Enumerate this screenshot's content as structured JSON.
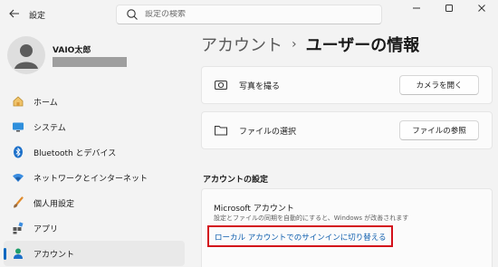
{
  "window": {
    "app_title": "設定",
    "search_placeholder": "設定の検索"
  },
  "user": {
    "name": "VAIO太郎"
  },
  "sidebar": {
    "items": [
      {
        "label": "ホーム",
        "icon": "home-icon"
      },
      {
        "label": "システム",
        "icon": "system-display-icon"
      },
      {
        "label": "Bluetooth とデバイス",
        "icon": "bluetooth-icon"
      },
      {
        "label": "ネットワークとインターネット",
        "icon": "wifi-icon"
      },
      {
        "label": "個人用設定",
        "icon": "brush-icon"
      },
      {
        "label": "アプリ",
        "icon": "apps-icon"
      },
      {
        "label": "アカウント",
        "icon": "account-icon",
        "selected": true
      }
    ]
  },
  "header": {
    "parent": "アカウント",
    "separator": "›",
    "current": "ユーザーの情報"
  },
  "cards": {
    "camera": {
      "label": "写真を撮る",
      "button": "カメラを開く",
      "icon": "camera-icon"
    },
    "file": {
      "label": "ファイルの選択",
      "button": "ファイルの参照",
      "icon": "folder-icon"
    }
  },
  "account_settings": {
    "heading": "アカウントの設定",
    "title": "Microsoft アカウント",
    "description": "設定とファイルの同期を自動的にすると、Windows が改善されます",
    "link": "ローカル アカウントでのサインインに切り替える"
  },
  "colors": {
    "accent": "#0067c0",
    "link": "#0b5cad",
    "highlight_frame": "#d3101a"
  }
}
